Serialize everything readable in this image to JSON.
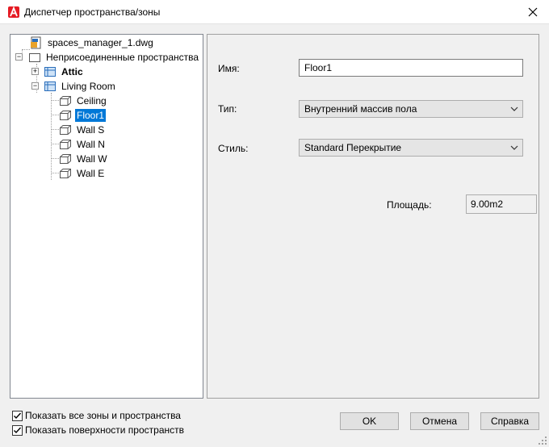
{
  "window": {
    "title": "Диспетчер пространства/зоны"
  },
  "tree": {
    "root": {
      "label": "spaces_manager_1.dwg"
    },
    "group": {
      "label": "Неприсоединенные пространства"
    },
    "attic": {
      "label": "Attic"
    },
    "living_room": {
      "label": "Living Room"
    },
    "surfaces": [
      {
        "label": "Ceiling",
        "selected": false
      },
      {
        "label": "Floor1",
        "selected": true
      },
      {
        "label": "Wall S",
        "selected": false
      },
      {
        "label": "Wall N",
        "selected": false
      },
      {
        "label": "Wall W",
        "selected": false
      },
      {
        "label": "Wall E",
        "selected": false
      }
    ]
  },
  "properties": {
    "name_label": "Имя:",
    "name_value": "Floor1",
    "type_label": "Тип:",
    "type_value": "Внутренний массив пола",
    "style_label": "Стиль:",
    "style_value": "Standard Перекрытие",
    "area_label": "Площадь:",
    "area_value": "9.00m2"
  },
  "options": {
    "show_all_zones": {
      "label": "Показать все зоны и пространства",
      "checked": true
    },
    "show_surfaces": {
      "label": "Показать поверхности пространств",
      "checked": true
    }
  },
  "buttons": {
    "ok": "OK",
    "cancel": "Отмена",
    "help": "Справка"
  },
  "colors": {
    "accent": "#0078d7",
    "app_icon": "#e51b24"
  }
}
